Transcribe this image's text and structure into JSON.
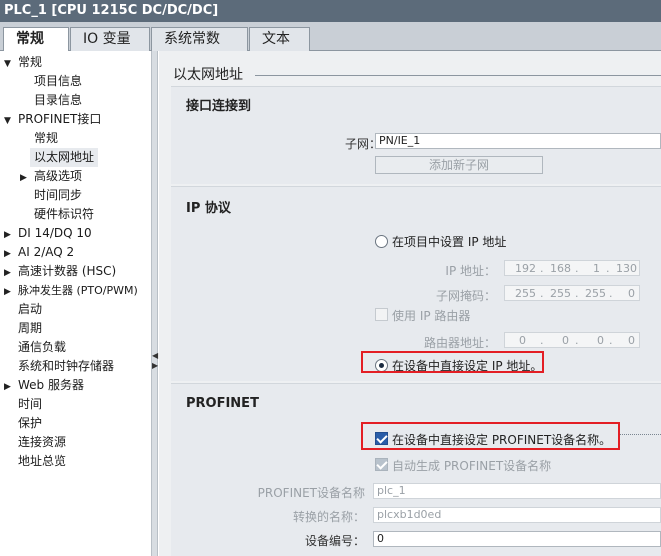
{
  "window": {
    "title": "PLC_1 [CPU 1215C DC/DC/DC]"
  },
  "tabs": [
    {
      "label": "常规",
      "active": true
    },
    {
      "label": "IO 变量",
      "active": false
    },
    {
      "label": "系统常数",
      "active": false
    },
    {
      "label": "文本",
      "active": false
    }
  ],
  "sidebar": {
    "items": [
      {
        "label": "常规",
        "expanded": true
      },
      {
        "label": "项目信息"
      },
      {
        "label": "目录信息"
      },
      {
        "label": "PROFINET接口",
        "expanded": true
      },
      {
        "label": "常规"
      },
      {
        "label": "以太网地址",
        "selected": true
      },
      {
        "label": "高级选项",
        "expanded": false
      },
      {
        "label": "时间同步"
      },
      {
        "label": "硬件标识符"
      },
      {
        "label": "DI 14/DQ 10",
        "expanded": false
      },
      {
        "label": "AI 2/AQ 2",
        "expanded": false
      },
      {
        "label": "高速计数器 (HSC)",
        "expanded": false
      },
      {
        "label": "脉冲发生器 (PTO/PWM)",
        "expanded": false
      },
      {
        "label": "启动"
      },
      {
        "label": "周期"
      },
      {
        "label": "通信负载"
      },
      {
        "label": "系统和时钟存储器"
      },
      {
        "label": "Web 服务器",
        "expanded": false
      },
      {
        "label": "时间"
      },
      {
        "label": "保护"
      },
      {
        "label": "连接资源"
      },
      {
        "label": "地址总览"
      }
    ]
  },
  "content": {
    "heading": "以太网地址",
    "interface": {
      "title": "接口连接到",
      "subnet_label": "子网：",
      "subnet_value": "PN/IE_1",
      "add_subnet_button": "添加新子网"
    },
    "ip": {
      "title": "IP 协议",
      "option_project_label": "在项目中设置 IP 地址",
      "option_project_selected": false,
      "ip_label": "IP 地址：",
      "ip_octets": [
        "192",
        "168",
        "1",
        "130"
      ],
      "mask_label": "子网掩码：",
      "mask_octets": [
        "255",
        "255",
        "255",
        "0"
      ],
      "use_router_label": "使用 IP 路由器",
      "use_router_checked": false,
      "router_label": "路由器地址：",
      "router_octets": [
        "0",
        "0",
        "0",
        "0"
      ],
      "option_device_label": "在设备中直接设定 IP 地址。",
      "option_device_selected": true
    },
    "profinet": {
      "title": "PROFINET",
      "set_name_on_device_label": "在设备中直接设定 PROFINET设备名称。",
      "set_name_on_device_checked": true,
      "auto_name_label": "自动生成 PROFINET设备名称",
      "auto_name_checked": true,
      "device_name_label": "PROFINET设备名称",
      "device_name_value": "plc_1",
      "converted_name_label": "转换的名称：",
      "converted_name_value": "plcxb1d0ed",
      "device_number_label": "设备编号：",
      "device_number_value": "0"
    }
  },
  "colors": {
    "titlebar": "#5c6b7a",
    "highlight": "#e31e24",
    "checkbox_on": "#2a5da8"
  }
}
